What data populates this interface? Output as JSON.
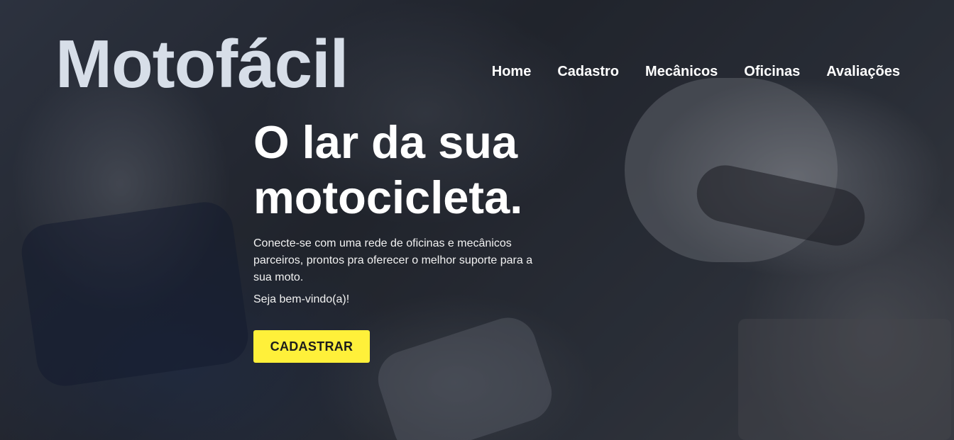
{
  "brand": {
    "logo_text": "Motofácil"
  },
  "nav": {
    "items": [
      {
        "label": "Home"
      },
      {
        "label": "Cadastro"
      },
      {
        "label": "Mecânicos"
      },
      {
        "label": "Oficinas"
      },
      {
        "label": "Avaliações"
      }
    ]
  },
  "hero": {
    "headline": "O lar da sua motocicleta.",
    "description": "Conecte-se com uma rede de oficinas e mecânicos parceiros, prontos pra oferecer o melhor suporte para a sua moto.",
    "welcome": "Seja bem-vindo(a)!",
    "cta_label": "CADASTRAR"
  },
  "colors": {
    "cta_background": "#fff03a",
    "cta_text": "#1c1c1c",
    "logo_text": "#d7dee8",
    "text": "#ffffff"
  }
}
